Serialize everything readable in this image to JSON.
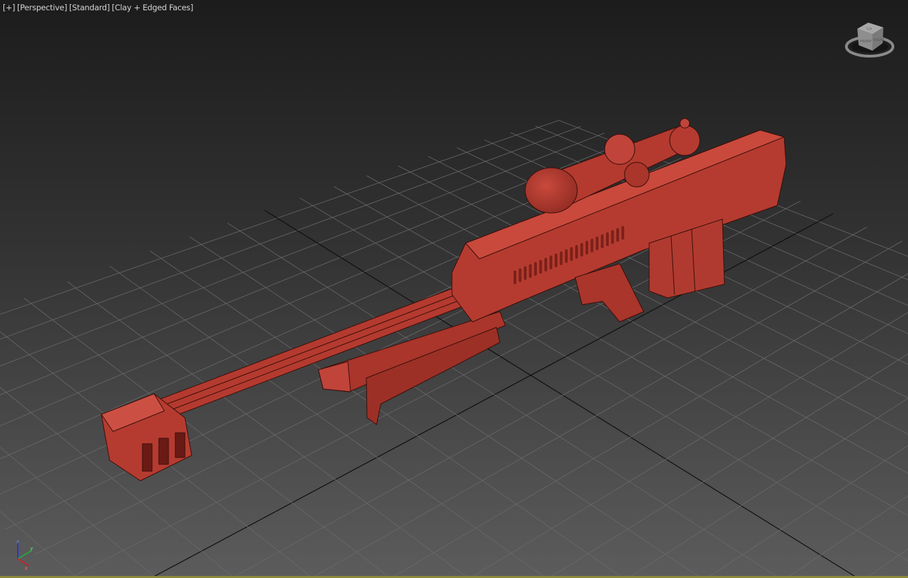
{
  "viewport": {
    "menu_plus": "[+]",
    "view_label": "[Perspective]",
    "shading_preset": "[Standard]",
    "display_mode": "[Clay + Edged Faces]",
    "active_border_color": "#8c8a3a"
  },
  "viewcube": {
    "faces": [
      "TOP",
      "FRONT",
      "RIGHT"
    ]
  },
  "axis_gizmo": {
    "x": "x",
    "y": "y",
    "z": "z",
    "colors": {
      "x": "#c0262a",
      "y": "#2aa040",
      "z": "#2a36c8"
    }
  },
  "model": {
    "clay_color": "#b53b30",
    "edge_color": "#3a0e0a"
  }
}
